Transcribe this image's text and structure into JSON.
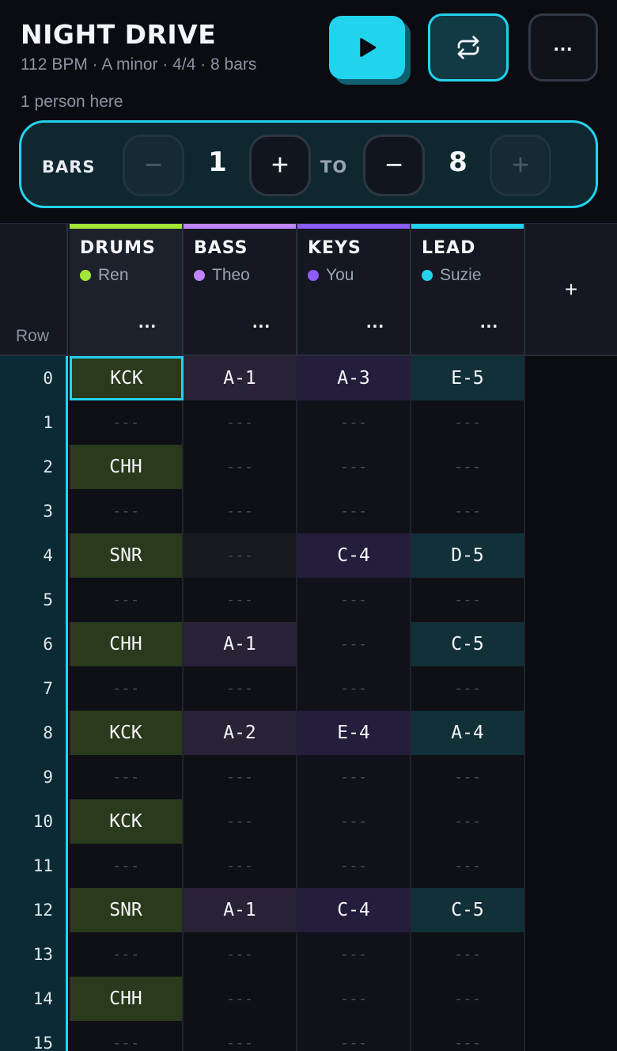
{
  "song": {
    "title": "NIGHT DRIVE",
    "meta": "112 BPM · A minor · 4/4 · 8 bars",
    "presence": "1 person here"
  },
  "transport": {
    "play_icon": "play-icon",
    "loop_icon": "loop-icon",
    "more_label": "..."
  },
  "range": {
    "label": "BARS",
    "to_label": "TO",
    "start": "1",
    "end": "8",
    "minus": "−",
    "plus": "+"
  },
  "grid": {
    "row_header": "Row",
    "add_track_label": "+",
    "track_menu_label": "...",
    "tracks": [
      {
        "name": "DRUMS",
        "user": "Ren",
        "color": "#a3e635"
      },
      {
        "name": "BASS",
        "user": "Theo",
        "color": "#c084fc"
      },
      {
        "name": "KEYS",
        "user": "You",
        "color": "#8b5cf6"
      },
      {
        "name": "LEAD",
        "user": "Suzie",
        "color": "#22d3ee"
      }
    ],
    "rows": [
      "0",
      "1",
      "2",
      "3",
      "4",
      "5",
      "6",
      "7",
      "8",
      "9",
      "10",
      "11",
      "12",
      "13",
      "14",
      "15"
    ],
    "cells": [
      [
        "KCK",
        "A-1",
        "A-3",
        "E-5"
      ],
      [
        "---",
        "---",
        "---",
        "---"
      ],
      [
        "CHH",
        "---",
        "---",
        "---"
      ],
      [
        "---",
        "---",
        "---",
        "---"
      ],
      [
        "SNR",
        "---",
        "C-4",
        "D-5"
      ],
      [
        "---",
        "---",
        "---",
        "---"
      ],
      [
        "CHH",
        "A-1",
        "---",
        "C-5"
      ],
      [
        "---",
        "---",
        "---",
        "---"
      ],
      [
        "KCK",
        "A-2",
        "E-4",
        "A-4"
      ],
      [
        "---",
        "---",
        "---",
        "---"
      ],
      [
        "KCK",
        "---",
        "---",
        "---"
      ],
      [
        "---",
        "---",
        "---",
        "---"
      ],
      [
        "SNR",
        "A-1",
        "C-4",
        "C-5"
      ],
      [
        "---",
        "---",
        "---",
        "---"
      ],
      [
        "CHH",
        "---",
        "---",
        "---"
      ],
      [
        "---",
        "---",
        "---",
        "---"
      ]
    ],
    "selected_cell": [
      0,
      0
    ],
    "note_colors": [
      "#2a3a1c",
      "#2a2237",
      "#241d3c",
      "#123038"
    ],
    "empty_colors": [
      "#0e1016",
      "#0e1016",
      "#111219",
      "#0e1016"
    ],
    "ghost_colors": [
      "#0e1016",
      "#17191f",
      "#1a1626",
      "#0e1016"
    ]
  }
}
